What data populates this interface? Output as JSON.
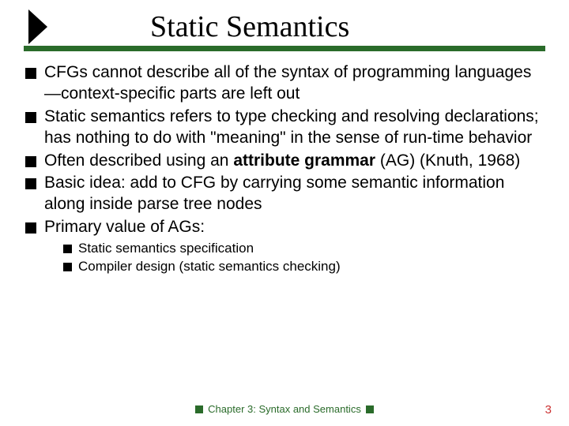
{
  "title": "Static Semantics",
  "bullets": [
    {
      "text": "CFGs cannot describe all of the syntax of programming languages—context-specific parts are left out"
    },
    {
      "text": "Static semantics refers to type checking and resolving declarations; has nothing to do with \"meaning\" in the sense of run-time behavior"
    },
    {
      "pre": "Often described using an ",
      "bold": "attribute grammar",
      "post": " (AG) (Knuth, 1968)"
    },
    {
      "text": "Basic idea: add to CFG by carrying some semantic information along inside parse tree nodes"
    },
    {
      "text": " Primary value of AGs:"
    }
  ],
  "subbullets": [
    "Static semantics specification",
    "Compiler design (static semantics checking)"
  ],
  "footer": "Chapter 3: Syntax and Semantics",
  "page": "3"
}
